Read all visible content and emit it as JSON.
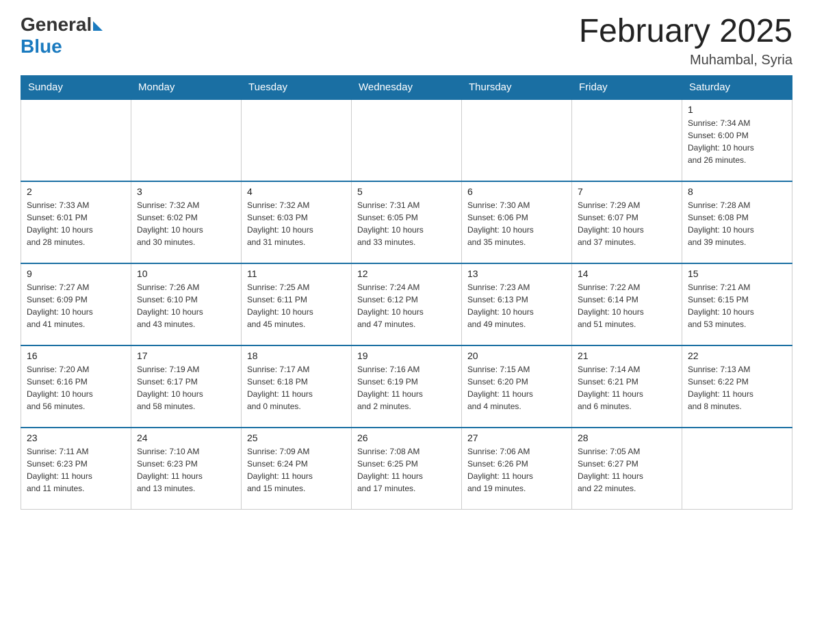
{
  "header": {
    "logo_general": "General",
    "logo_blue": "Blue",
    "month_title": "February 2025",
    "location": "Muhambal, Syria"
  },
  "weekdays": [
    "Sunday",
    "Monday",
    "Tuesday",
    "Wednesday",
    "Thursday",
    "Friday",
    "Saturday"
  ],
  "weeks": [
    [
      {
        "day": "",
        "info": ""
      },
      {
        "day": "",
        "info": ""
      },
      {
        "day": "",
        "info": ""
      },
      {
        "day": "",
        "info": ""
      },
      {
        "day": "",
        "info": ""
      },
      {
        "day": "",
        "info": ""
      },
      {
        "day": "1",
        "info": "Sunrise: 7:34 AM\nSunset: 6:00 PM\nDaylight: 10 hours\nand 26 minutes."
      }
    ],
    [
      {
        "day": "2",
        "info": "Sunrise: 7:33 AM\nSunset: 6:01 PM\nDaylight: 10 hours\nand 28 minutes."
      },
      {
        "day": "3",
        "info": "Sunrise: 7:32 AM\nSunset: 6:02 PM\nDaylight: 10 hours\nand 30 minutes."
      },
      {
        "day": "4",
        "info": "Sunrise: 7:32 AM\nSunset: 6:03 PM\nDaylight: 10 hours\nand 31 minutes."
      },
      {
        "day": "5",
        "info": "Sunrise: 7:31 AM\nSunset: 6:05 PM\nDaylight: 10 hours\nand 33 minutes."
      },
      {
        "day": "6",
        "info": "Sunrise: 7:30 AM\nSunset: 6:06 PM\nDaylight: 10 hours\nand 35 minutes."
      },
      {
        "day": "7",
        "info": "Sunrise: 7:29 AM\nSunset: 6:07 PM\nDaylight: 10 hours\nand 37 minutes."
      },
      {
        "day": "8",
        "info": "Sunrise: 7:28 AM\nSunset: 6:08 PM\nDaylight: 10 hours\nand 39 minutes."
      }
    ],
    [
      {
        "day": "9",
        "info": "Sunrise: 7:27 AM\nSunset: 6:09 PM\nDaylight: 10 hours\nand 41 minutes."
      },
      {
        "day": "10",
        "info": "Sunrise: 7:26 AM\nSunset: 6:10 PM\nDaylight: 10 hours\nand 43 minutes."
      },
      {
        "day": "11",
        "info": "Sunrise: 7:25 AM\nSunset: 6:11 PM\nDaylight: 10 hours\nand 45 minutes."
      },
      {
        "day": "12",
        "info": "Sunrise: 7:24 AM\nSunset: 6:12 PM\nDaylight: 10 hours\nand 47 minutes."
      },
      {
        "day": "13",
        "info": "Sunrise: 7:23 AM\nSunset: 6:13 PM\nDaylight: 10 hours\nand 49 minutes."
      },
      {
        "day": "14",
        "info": "Sunrise: 7:22 AM\nSunset: 6:14 PM\nDaylight: 10 hours\nand 51 minutes."
      },
      {
        "day": "15",
        "info": "Sunrise: 7:21 AM\nSunset: 6:15 PM\nDaylight: 10 hours\nand 53 minutes."
      }
    ],
    [
      {
        "day": "16",
        "info": "Sunrise: 7:20 AM\nSunset: 6:16 PM\nDaylight: 10 hours\nand 56 minutes."
      },
      {
        "day": "17",
        "info": "Sunrise: 7:19 AM\nSunset: 6:17 PM\nDaylight: 10 hours\nand 58 minutes."
      },
      {
        "day": "18",
        "info": "Sunrise: 7:17 AM\nSunset: 6:18 PM\nDaylight: 11 hours\nand 0 minutes."
      },
      {
        "day": "19",
        "info": "Sunrise: 7:16 AM\nSunset: 6:19 PM\nDaylight: 11 hours\nand 2 minutes."
      },
      {
        "day": "20",
        "info": "Sunrise: 7:15 AM\nSunset: 6:20 PM\nDaylight: 11 hours\nand 4 minutes."
      },
      {
        "day": "21",
        "info": "Sunrise: 7:14 AM\nSunset: 6:21 PM\nDaylight: 11 hours\nand 6 minutes."
      },
      {
        "day": "22",
        "info": "Sunrise: 7:13 AM\nSunset: 6:22 PM\nDaylight: 11 hours\nand 8 minutes."
      }
    ],
    [
      {
        "day": "23",
        "info": "Sunrise: 7:11 AM\nSunset: 6:23 PM\nDaylight: 11 hours\nand 11 minutes."
      },
      {
        "day": "24",
        "info": "Sunrise: 7:10 AM\nSunset: 6:23 PM\nDaylight: 11 hours\nand 13 minutes."
      },
      {
        "day": "25",
        "info": "Sunrise: 7:09 AM\nSunset: 6:24 PM\nDaylight: 11 hours\nand 15 minutes."
      },
      {
        "day": "26",
        "info": "Sunrise: 7:08 AM\nSunset: 6:25 PM\nDaylight: 11 hours\nand 17 minutes."
      },
      {
        "day": "27",
        "info": "Sunrise: 7:06 AM\nSunset: 6:26 PM\nDaylight: 11 hours\nand 19 minutes."
      },
      {
        "day": "28",
        "info": "Sunrise: 7:05 AM\nSunset: 6:27 PM\nDaylight: 11 hours\nand 22 minutes."
      },
      {
        "day": "",
        "info": ""
      }
    ]
  ]
}
